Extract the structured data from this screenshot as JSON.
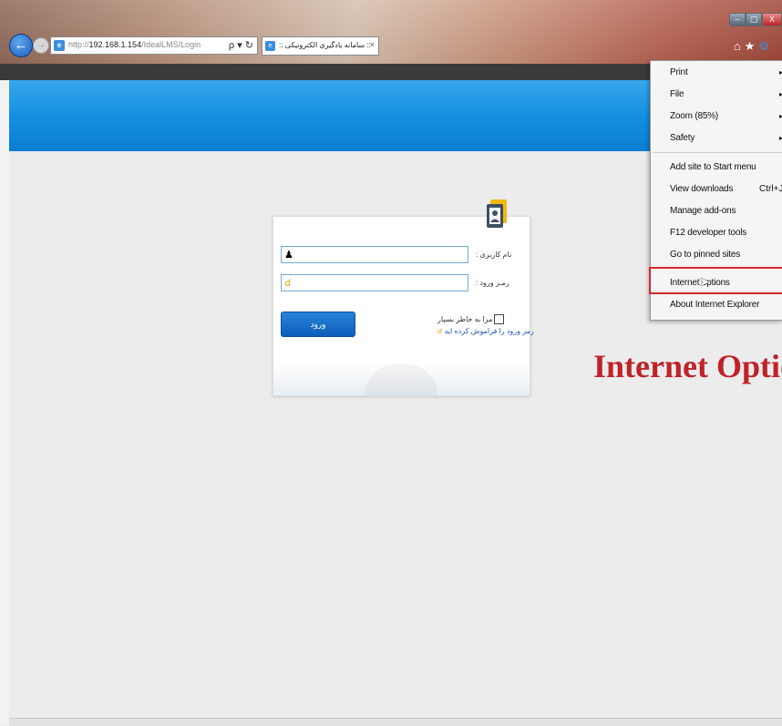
{
  "browser": {
    "address_prefix": "http://",
    "address_host": "192.168.1.154",
    "address_path": "/IdealLMS/Login",
    "address_icons": "ρ ▾ ↻",
    "tab_title": ":: سامانه یادگیری الکترونیکی ::",
    "tab_close": "×",
    "back_glyph": "←",
    "forward_glyph": "→",
    "window_controls": [
      "–",
      "▢",
      "X"
    ],
    "toolbar_icons": [
      "⌂",
      "★"
    ]
  },
  "login": {
    "username_label": "نام کاربری :",
    "password_label": "رمـز ورود :",
    "login_button": "ورود",
    "remember_me": "مرا به خاطر بسپار",
    "forgot_password": "رمز ورود را فراموش کرده اید"
  },
  "menu": {
    "items": [
      {
        "label": "Print",
        "arrow": "▸"
      },
      {
        "label": "File",
        "arrow": "▸"
      },
      {
        "label": "Zoom (85%)",
        "arrow": "▸"
      },
      {
        "label": "Safety",
        "arrow": "▸"
      },
      {
        "label": "Add site to Start menu"
      },
      {
        "label": "View downloads",
        "shortcut": "Ctrl+J"
      },
      {
        "label": "Manage add-ons"
      },
      {
        "label": "F12 developer tools"
      },
      {
        "label": "Go to pinned sites"
      },
      {
        "label": "Internet options"
      },
      {
        "label": "About Internet Explorer"
      }
    ]
  },
  "annotation": {
    "text": "Internet Option",
    "color": "#c0222a"
  },
  "colors": {
    "banner": "#1590e0",
    "login_button": "#0c5ebb",
    "highlight": "#d22a2a"
  }
}
